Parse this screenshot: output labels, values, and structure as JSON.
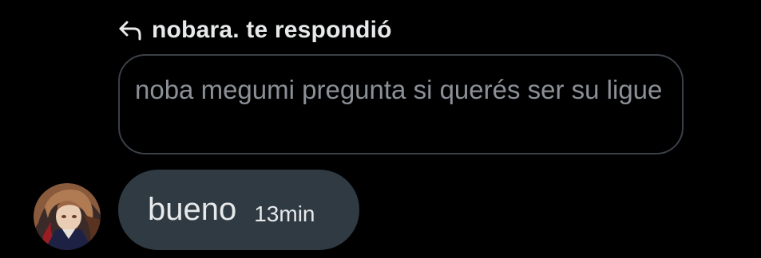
{
  "reply_header": {
    "icon": "reply-arrow-icon",
    "text": "nobara. te respondió"
  },
  "quoted_message": {
    "text": "noba megumi pregunta si querés ser su ligue"
  },
  "message": {
    "text": "bueno",
    "time": "13min",
    "avatar": "user-avatar"
  },
  "colors": {
    "background": "#000000",
    "bubble": "#2f3a43",
    "quoted_border": "#3b4148",
    "quoted_text": "#8b9097",
    "primary_text": "#e7e9ea"
  }
}
